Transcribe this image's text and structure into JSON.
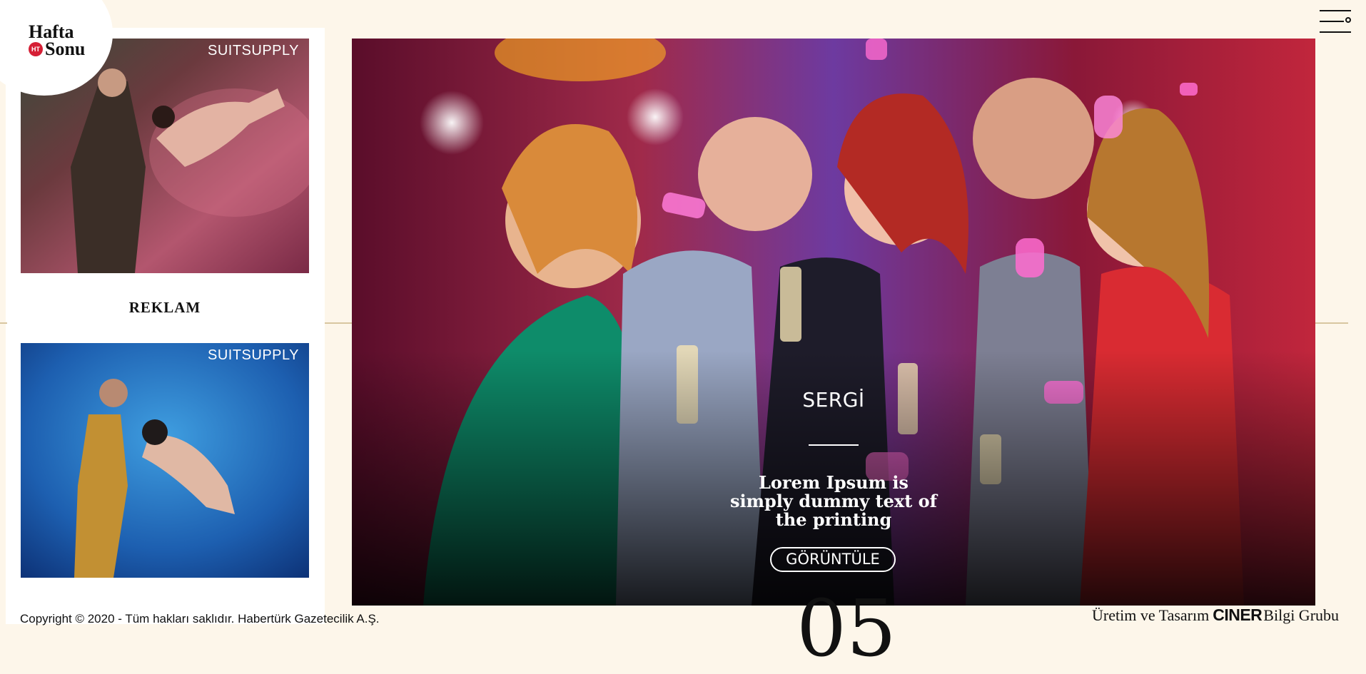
{
  "logo": {
    "line1": "Hafta",
    "line2": "Sonu",
    "badge": "HT"
  },
  "ads": {
    "top": {
      "brand": "SUITSUPPLY"
    },
    "label": "REKLAM",
    "bottom": {
      "brand": "SUITSUPPLY"
    }
  },
  "hero": {
    "category": "SERGİ",
    "title": "Lorem Ipsum is simply dummy text of the printing",
    "button": "GÖRÜNTÜLE"
  },
  "menu": {
    "icon": "hamburger-menu-icon"
  },
  "footer": {
    "copyright": "Copyright © 2020 - Tüm hakları saklıdır. Habertürk Gazetecilik A.Ş.",
    "slide_number": "05",
    "credits_prefix": "Üretim ve Tasarım",
    "credits_brand": "CINER",
    "credits_suffix": "Bilgi Grubu"
  },
  "colors": {
    "background": "#fdf6ea",
    "divider": "#d8c6a0",
    "logo_badge": "#d51f35"
  }
}
